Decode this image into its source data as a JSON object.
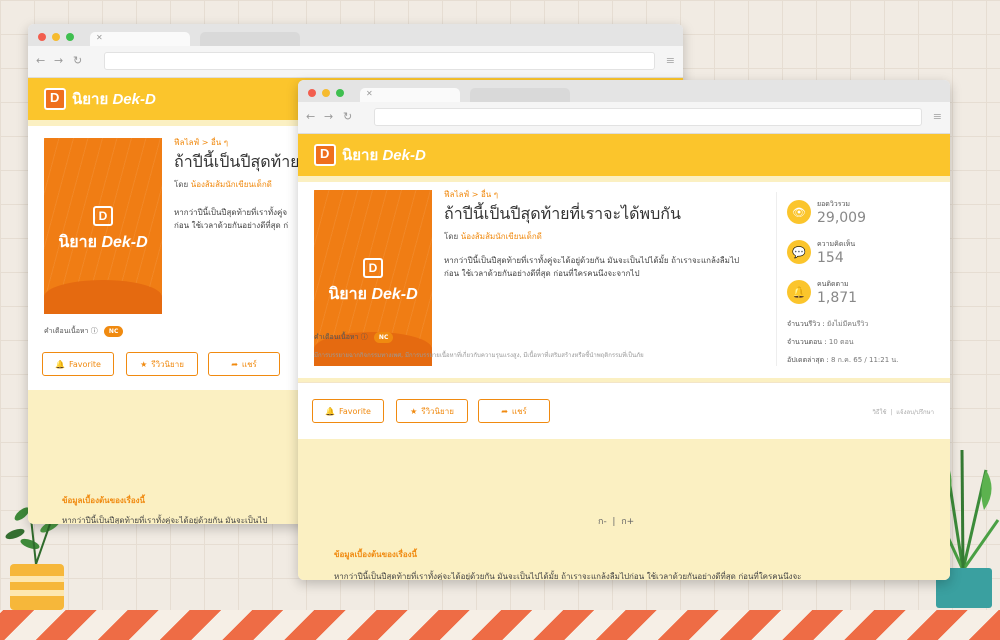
{
  "logo": {
    "thai": "นิยาย",
    "brand": "Dek-D",
    "mark": "D"
  },
  "story": {
    "breadcrumb": "ฟีลไลฟ์ > อื่น ๆ",
    "title": "ถ้าปีนี้เป็นปีสุดท้ายที่เราจะได้พบกัน",
    "by_label": "โดย",
    "author": "น้องส้มส้มนักเขียนเด็กดี",
    "summary_line1": "หากว่าปีนี้เป็นปีสุดท้ายที่เราทั้งคู่จะได้อยู่ด้วยกัน มันจะเป็นไปได้มั้ย ถ้าเราจะแกล้งลืมไป",
    "summary_line2": "ก่อน ใช้เวลาด้วยกันอย่างดีที่สุด ก่อนที่ใครคนนึงจะจากไป",
    "summary_back_line1": "หากว่าปีนี้เป็นปีสุดท้ายที่เราทั้งคู่จ",
    "summary_back_line2": "ก่อน ใช้เวลาด้วยกันอย่างดีที่สุด ก่"
  },
  "stats": {
    "views_label": "ยอดวิวรวม",
    "views": "29,009",
    "comments_label": "ความคิดเห็น",
    "comments": "154",
    "followers_label": "คนติดตาม",
    "followers": "1,871",
    "reviews_label": "จำนวนรีวิว :",
    "reviews_value": "ยังไม่มีคนรีวิว",
    "episodes_label": "จำนวนตอน :",
    "episodes_value": "10 ตอน",
    "updated_label": "อัปเดตล่าสุด :",
    "updated_value": "8 ก.ค. 65 / 11:21 น."
  },
  "warning": {
    "label": "คำเตือนเนื้อหา",
    "badge": "NC",
    "detail": "มีการบรรยายฉากกิจกรรมทางเพศ, มีการบรรยายเนื้อหาที่เกี่ยวกับความรุนแรงสูง, มีเนื้อหาที่เสริมสร้างหรือชี้นำพฤติกรรมที่เป็นภัย"
  },
  "actions": {
    "favorite": "Favorite",
    "review": "รีวิวนิยาย",
    "share": "แชร์",
    "right_link1": "วิธีใช้",
    "right_link2": "แจ้งลบ/ปรึกษา"
  },
  "pager": {
    "minus": "ก-",
    "plus": "ก+"
  },
  "intro": {
    "heading": "ข้อมูลเบื้องต้นของเรื่องนี้",
    "text": "หากว่าปีนี้เป็นปีสุดท้ายที่เราทั้งคู่จะได้อยู่ด้วยกัน มันจะเป็นไปได้มั้ย ถ้าเราจะแกล้งลืมไปก่อน ใช้เวลาด้วยกันอย่างดีที่สุด ก่อนที่ใครคนนึงจะ",
    "text_back": "หากว่าปีนี้เป็นปีสุดท้ายที่เราทั้งคู่จะได้อยู่ด้วยกัน มันจะเป็นไป"
  },
  "colors": {
    "accent": "#f08a10",
    "header": "#fbc52c",
    "cover": "#f07d14"
  }
}
